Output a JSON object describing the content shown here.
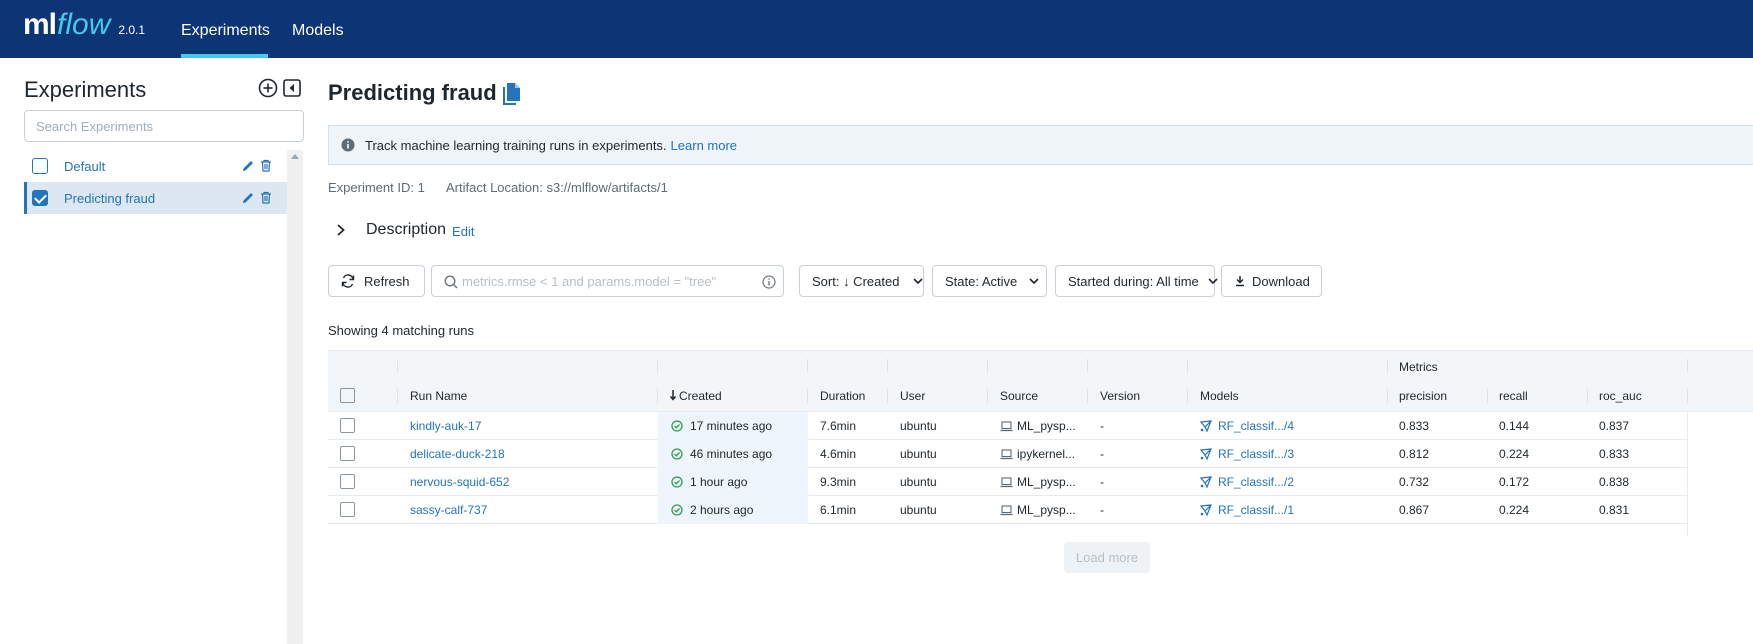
{
  "header": {
    "logo_ml": "ml",
    "logo_flow": "flow",
    "version": "2.0.1",
    "tabs": [
      {
        "label": "Experiments",
        "active": true
      },
      {
        "label": "Models",
        "active": false
      }
    ]
  },
  "sidebar": {
    "title": "Experiments",
    "search_placeholder": "Search Experiments",
    "experiments": [
      {
        "name": "Default",
        "checked": false
      },
      {
        "name": "Predicting fraud",
        "checked": true
      }
    ]
  },
  "main": {
    "title": "Predicting fraud",
    "banner_text": "Track machine learning training runs in experiments.",
    "banner_link": "Learn more",
    "experiment_id": "Experiment ID: 1",
    "artifact_location": "Artifact Location: s3://mlflow/artifacts/1",
    "description_label": "Description",
    "description_edit": "Edit",
    "toolbar": {
      "refresh": "Refresh",
      "search_placeholder": "metrics.rmse < 1 and params.model = \"tree\"",
      "sort": "Sort: ↓ Created",
      "state": "State: Active",
      "started": "Started during: All time",
      "download": "Download"
    },
    "showing": "Showing 4 matching runs",
    "table": {
      "group_header": "Metrics",
      "columns": [
        "Run Name",
        "Created",
        "Duration",
        "User",
        "Source",
        "Version",
        "Models",
        "precision",
        "recall",
        "roc_auc"
      ],
      "rows": [
        {
          "run_name": "kindly-auk-17",
          "created": "17 minutes ago",
          "duration": "7.6min",
          "user": "ubuntu",
          "source": "ML_pysp...",
          "version": "-",
          "model": "RF_classif.../4",
          "precision": "0.833",
          "recall": "0.144",
          "roc_auc": "0.837"
        },
        {
          "run_name": "delicate-duck-218",
          "created": "46 minutes ago",
          "duration": "4.6min",
          "user": "ubuntu",
          "source": "ipykernel...",
          "version": "-",
          "model": "RF_classif.../3",
          "precision": "0.812",
          "recall": "0.224",
          "roc_auc": "0.833"
        },
        {
          "run_name": "nervous-squid-652",
          "created": "1 hour ago",
          "duration": "9.3min",
          "user": "ubuntu",
          "source": "ML_pysp...",
          "version": "-",
          "model": "RF_classif.../2",
          "precision": "0.732",
          "recall": "0.172",
          "roc_auc": "0.838"
        },
        {
          "run_name": "sassy-calf-737",
          "created": "2 hours ago",
          "duration": "6.1min",
          "user": "ubuntu",
          "source": "ML_pysp...",
          "version": "-",
          "model": "RF_classif.../1",
          "precision": "0.867",
          "recall": "0.224",
          "roc_auc": "0.831"
        }
      ]
    },
    "load_more": "Load more"
  },
  "colors": {
    "header_bg": "#0b3574",
    "accent": "#43c9ed",
    "link": "#2374bb",
    "success": "#2e9e4f"
  }
}
